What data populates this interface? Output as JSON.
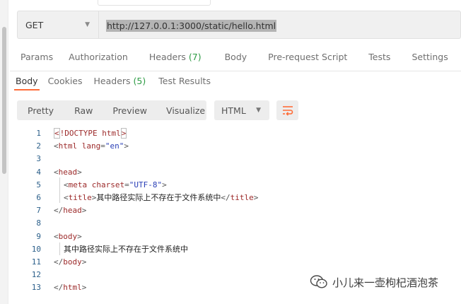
{
  "request": {
    "method": "GET",
    "url": "http://127.0.0.1:3000/static/hello.html"
  },
  "request_tabs": [
    {
      "label": "Params",
      "count": ""
    },
    {
      "label": "Authorization",
      "count": ""
    },
    {
      "label": "Headers",
      "count": "(7)"
    },
    {
      "label": "Body",
      "count": ""
    },
    {
      "label": "Pre-request Script",
      "count": ""
    },
    {
      "label": "Tests",
      "count": ""
    },
    {
      "label": "Settings",
      "count": ""
    }
  ],
  "response_tabs": [
    {
      "label": "Body",
      "count": "",
      "active": true
    },
    {
      "label": "Cookies",
      "count": ""
    },
    {
      "label": "Headers",
      "count": "(5)"
    },
    {
      "label": "Test Results",
      "count": ""
    }
  ],
  "view_modes": [
    "Pretty",
    "Raw",
    "Preview",
    "Visualize"
  ],
  "format": "HTML",
  "icons": {
    "method_caret": "chevron-down-icon",
    "format_caret": "chevron-down-icon",
    "wrap": "wrap-lines-icon",
    "watermark": "wechat-logo-icon"
  },
  "accent_color": "#ff6c37",
  "count_color": "#2d9b44",
  "code_lines": [
    {
      "n": "1",
      "tokens": [
        {
          "c": "box",
          "t": "<"
        },
        {
          "c": "tag",
          "t": "!DOCTYPE "
        },
        {
          "c": "attr",
          "t": "html"
        },
        {
          "c": "box",
          "t": ">"
        }
      ]
    },
    {
      "n": "2",
      "tokens": [
        {
          "c": "punc",
          "t": "<"
        },
        {
          "c": "tag",
          "t": "html "
        },
        {
          "c": "attr",
          "t": "lang"
        },
        {
          "c": "punc",
          "t": "="
        },
        {
          "c": "str",
          "t": "\"en\""
        },
        {
          "c": "punc",
          "t": ">"
        }
      ]
    },
    {
      "n": "3",
      "tokens": []
    },
    {
      "n": "4",
      "tokens": [
        {
          "c": "punc",
          "t": "<"
        },
        {
          "c": "tag",
          "t": "head"
        },
        {
          "c": "punc",
          "t": ">"
        }
      ]
    },
    {
      "n": "5",
      "tokens": [
        {
          "c": "text",
          "t": "    "
        },
        {
          "c": "punc",
          "t": "<"
        },
        {
          "c": "tag",
          "t": "meta "
        },
        {
          "c": "attr",
          "t": "charset"
        },
        {
          "c": "punc",
          "t": "="
        },
        {
          "c": "str",
          "t": "\"UTF-8\""
        },
        {
          "c": "punc",
          "t": ">"
        }
      ]
    },
    {
      "n": "6",
      "tokens": [
        {
          "c": "text",
          "t": "    "
        },
        {
          "c": "punc",
          "t": "<"
        },
        {
          "c": "tag",
          "t": "title"
        },
        {
          "c": "punc",
          "t": ">"
        },
        {
          "c": "text",
          "t": "其中路径实际上不存在于文件系统中"
        },
        {
          "c": "punc",
          "t": "</"
        },
        {
          "c": "tag",
          "t": "title"
        },
        {
          "c": "punc",
          "t": ">"
        }
      ]
    },
    {
      "n": "7",
      "tokens": [
        {
          "c": "punc",
          "t": "</"
        },
        {
          "c": "tag",
          "t": "head"
        },
        {
          "c": "punc",
          "t": ">"
        }
      ]
    },
    {
      "n": "8",
      "tokens": []
    },
    {
      "n": "9",
      "tokens": [
        {
          "c": "punc",
          "t": "<"
        },
        {
          "c": "tag",
          "t": "body"
        },
        {
          "c": "punc",
          "t": ">"
        }
      ]
    },
    {
      "n": "10",
      "tokens": [
        {
          "c": "text",
          "t": "    其中路径实际上不存在于文件系统中"
        }
      ]
    },
    {
      "n": "11",
      "tokens": [
        {
          "c": "punc",
          "t": "</"
        },
        {
          "c": "tag",
          "t": "body"
        },
        {
          "c": "punc",
          "t": ">"
        }
      ]
    },
    {
      "n": "12",
      "tokens": []
    },
    {
      "n": "13",
      "tokens": [
        {
          "c": "punc",
          "t": "</"
        },
        {
          "c": "tag",
          "t": "html"
        },
        {
          "c": "punc",
          "t": ">"
        }
      ]
    }
  ],
  "watermark": {
    "text": "小儿来一壶枸杞酒泡茶"
  }
}
